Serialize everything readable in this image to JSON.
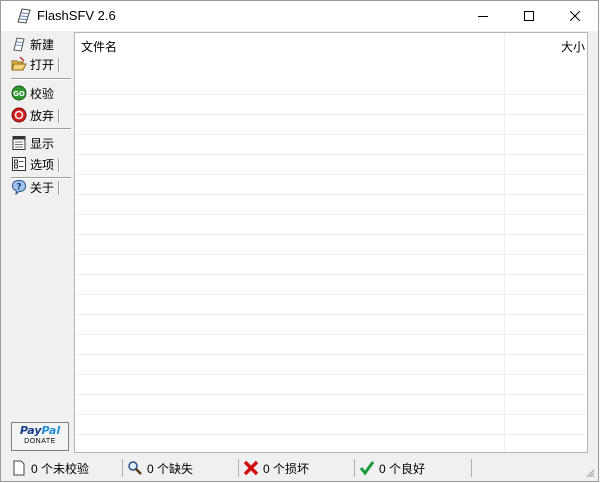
{
  "window": {
    "title": "FlashSFV 2.6",
    "app_icon": "flashsfv-app-icon"
  },
  "toolbar": {
    "items": [
      {
        "label": "新建",
        "icon": "new-icon"
      },
      {
        "label": "打开",
        "icon": "open-icon"
      },
      {
        "label": "校验",
        "icon": "go-icon"
      },
      {
        "label": "放弃",
        "icon": "stop-icon"
      },
      {
        "label": "显示",
        "icon": "display-icon"
      },
      {
        "label": "选项",
        "icon": "options-icon"
      },
      {
        "label": "关于",
        "icon": "help-icon"
      }
    ],
    "donate": {
      "brand_a": "Pay",
      "brand_b": "Pal",
      "sub": "DONATE"
    }
  },
  "list": {
    "columns": [
      "文件名",
      "大小"
    ],
    "rows": []
  },
  "statusbar": {
    "unchecked": "0 个未校验",
    "missing": "0 个缺失",
    "broken": "0 个损坏",
    "good": "0 个良好"
  },
  "colors": {
    "go_green": "#2e9a2e",
    "stop_red": "#d42020",
    "error_red": "#d01010",
    "ok_green": "#1a9a3a",
    "paypal_blue": "#123e8a"
  }
}
